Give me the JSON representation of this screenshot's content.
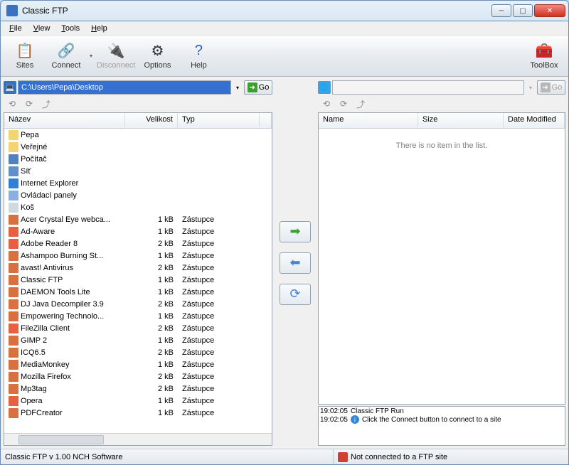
{
  "window": {
    "title": "Classic FTP"
  },
  "menu": {
    "file": "File",
    "view": "View",
    "tools": "Tools",
    "help": "Help"
  },
  "toolbar": {
    "sites": "Sites",
    "connect": "Connect",
    "disconnect": "Disconnect",
    "options": "Options",
    "help": "Help",
    "toolbox": "ToolBox"
  },
  "local": {
    "path": "C:\\Users\\Pepa\\Desktop",
    "go": "Go",
    "columns": {
      "name": "Název",
      "size": "Velikost",
      "type": "Typ"
    },
    "items": [
      {
        "icon": "ic-folder",
        "name": "Pepa",
        "size": "",
        "type": ""
      },
      {
        "icon": "ic-folder",
        "name": "Veřejné",
        "size": "",
        "type": ""
      },
      {
        "icon": "ic-computer",
        "name": "Počítač",
        "size": "",
        "type": ""
      },
      {
        "icon": "ic-network",
        "name": "Síť",
        "size": "",
        "type": ""
      },
      {
        "icon": "ic-ie",
        "name": "Internet Explorer",
        "size": "",
        "type": ""
      },
      {
        "icon": "ic-panel",
        "name": "Ovládací panely",
        "size": "",
        "type": ""
      },
      {
        "icon": "ic-bin",
        "name": "Koš",
        "size": "",
        "type": ""
      },
      {
        "icon": "ic-link",
        "name": "Acer Crystal Eye webca...",
        "size": "1 kB",
        "type": "Zástupce"
      },
      {
        "icon": "ic-app",
        "name": "Ad-Aware",
        "size": "1 kB",
        "type": "Zástupce"
      },
      {
        "icon": "ic-app",
        "name": "Adobe Reader 8",
        "size": "2 kB",
        "type": "Zástupce"
      },
      {
        "icon": "ic-link",
        "name": "Ashampoo Burning St...",
        "size": "1 kB",
        "type": "Zástupce"
      },
      {
        "icon": "ic-link",
        "name": "avast! Antivirus",
        "size": "2 kB",
        "type": "Zástupce"
      },
      {
        "icon": "ic-link",
        "name": "Classic FTP",
        "size": "1 kB",
        "type": "Zástupce"
      },
      {
        "icon": "ic-link",
        "name": "DAEMON Tools Lite",
        "size": "1 kB",
        "type": "Zástupce"
      },
      {
        "icon": "ic-link",
        "name": "DJ Java Decompiler 3.9",
        "size": "2 kB",
        "type": "Zástupce"
      },
      {
        "icon": "ic-link",
        "name": "Empowering Technolo...",
        "size": "1 kB",
        "type": "Zástupce"
      },
      {
        "icon": "ic-app",
        "name": "FileZilla Client",
        "size": "2 kB",
        "type": "Zástupce"
      },
      {
        "icon": "ic-link",
        "name": "GIMP 2",
        "size": "1 kB",
        "type": "Zástupce"
      },
      {
        "icon": "ic-link",
        "name": "ICQ6.5",
        "size": "2 kB",
        "type": "Zástupce"
      },
      {
        "icon": "ic-link",
        "name": "MediaMonkey",
        "size": "1 kB",
        "type": "Zástupce"
      },
      {
        "icon": "ic-link",
        "name": "Mozilla Firefox",
        "size": "2 kB",
        "type": "Zástupce"
      },
      {
        "icon": "ic-link",
        "name": "Mp3tag",
        "size": "2 kB",
        "type": "Zástupce"
      },
      {
        "icon": "ic-app",
        "name": "Opera",
        "size": "1 kB",
        "type": "Zástupce"
      },
      {
        "icon": "ic-link",
        "name": "PDFCreator",
        "size": "1 kB",
        "type": "Zástupce"
      }
    ]
  },
  "remote": {
    "go": "Go",
    "columns": {
      "name": "Name",
      "size": "Size",
      "date": "Date Modified"
    },
    "empty": "There is no item in the list."
  },
  "log": [
    {
      "time": "19:02:05",
      "icon": "",
      "msg": "Classic FTP Run"
    },
    {
      "time": "19:02:05",
      "icon": "info",
      "msg": "Click the Connect button to connect to a site"
    }
  ],
  "status": {
    "version": "Classic FTP v 1.00  NCH Software",
    "connection": "Not connected to a FTP site"
  }
}
